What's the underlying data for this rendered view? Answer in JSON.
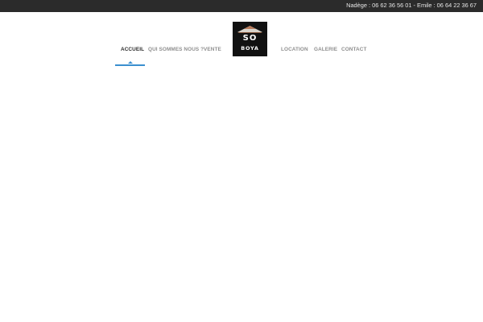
{
  "topbar": {
    "contact_text": "Nadège : 06 62 36 56 01 - Emile : 06 64 22 36 67"
  },
  "nav": {
    "accueil": "ACCUEIL",
    "qui_sommes_nous": "QUI SOMMES NOUS ?",
    "vente": "VENTE",
    "location": "LOCATION",
    "galerie": "GALERIE",
    "contact": "CONTACT",
    "active_item": "ACCUEIL"
  },
  "logo": {
    "line1": "SO",
    "line2": "BOYA",
    "icon": "mountain-icon"
  },
  "colors": {
    "topbar": "#2b2b2b",
    "accent": "#3a8fcf",
    "nav_text": "#8f8f8f",
    "nav_active": "#2a2a2a",
    "logo_bg": "#111111"
  }
}
